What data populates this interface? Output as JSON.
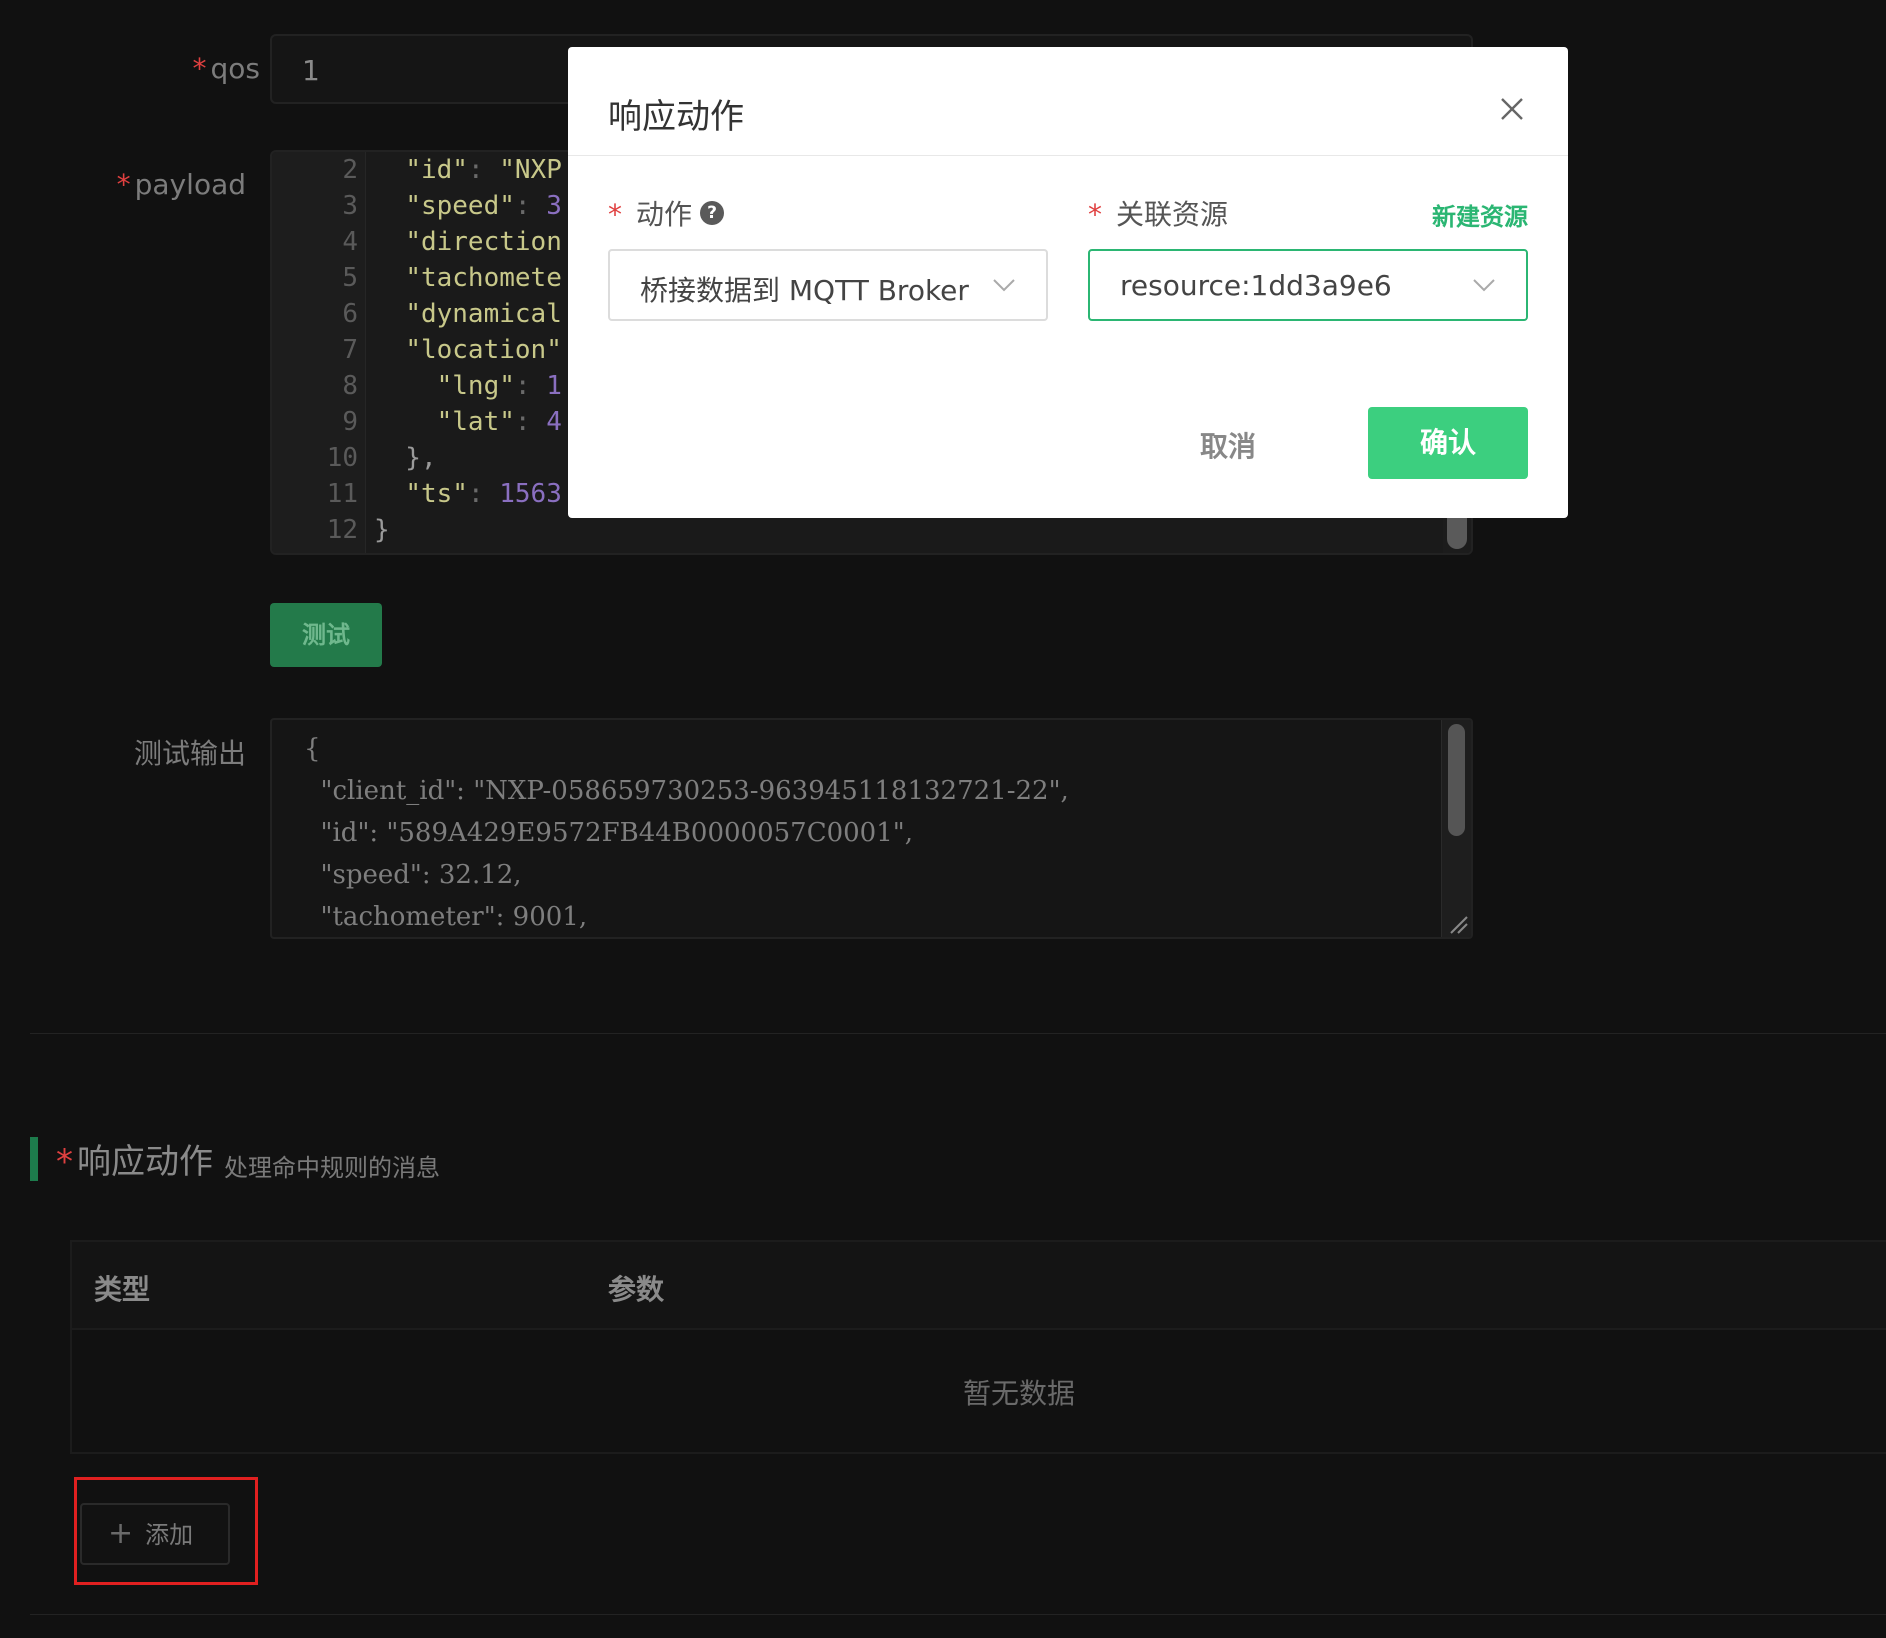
{
  "form": {
    "qos_label": "qos",
    "qos_value": "1",
    "payload_label": "payload",
    "test_button": "测试",
    "test_output_label": "测试输出"
  },
  "payload_lines": [
    {
      "n": "2",
      "t": "  \"id\": \"NXP"
    },
    {
      "n": "3",
      "t": "  \"speed\": 3"
    },
    {
      "n": "4",
      "t": "  \"direction"
    },
    {
      "n": "5",
      "t": "  \"tachomete"
    },
    {
      "n": "6",
      "t": "  \"dynamical"
    },
    {
      "n": "7",
      "t": "  \"location\""
    },
    {
      "n": "8",
      "t": "    \"lng\": 1"
    },
    {
      "n": "9",
      "t": "    \"lat\": 4"
    },
    {
      "n": "10",
      "t": "  },"
    },
    {
      "n": "11",
      "t": "  \"ts\": 1563"
    },
    {
      "n": "12",
      "t": "}"
    }
  ],
  "test_output_lines": [
    "{",
    "  \"client_id\": \"NXP-058659730253-963945118132721-22\",",
    "  \"id\": \"589A429E9572FB44B0000057C0001\",",
    "  \"speed\": 32.12,",
    "  \"tachometer\": 9001,"
  ],
  "section": {
    "title": "响应动作",
    "description": "处理命中规则的消息"
  },
  "table": {
    "columns": [
      "类型",
      "参数"
    ],
    "empty_text": "暂无数据"
  },
  "add_button": "添加",
  "modal": {
    "title": "响应动作",
    "action_label": "动作",
    "action_value": "桥接数据到 MQTT Broker",
    "resource_label": "关联资源",
    "resource_value": "resource:1dd3a9e6",
    "new_resource_link": "新建资源",
    "cancel": "取消",
    "confirm": "确认"
  },
  "colors": {
    "accent_green": "#3ccf7f",
    "highlight_red": "#e02020"
  }
}
